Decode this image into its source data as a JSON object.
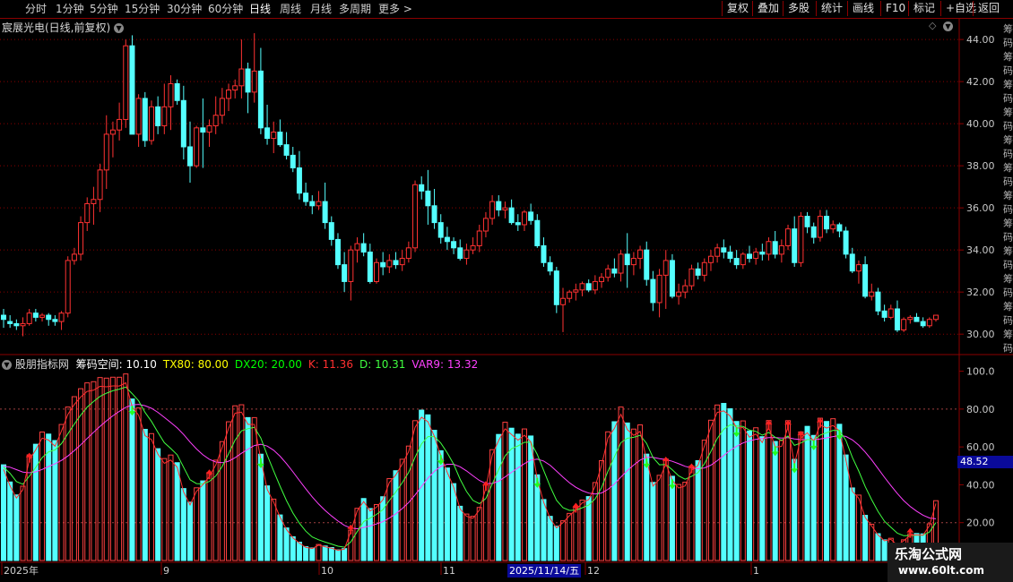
{
  "toolbar": {
    "periods": [
      "分时",
      "1分钟",
      "5分钟",
      "15分钟",
      "30分钟",
      "60分钟",
      "日线",
      "周线",
      "月线",
      "多周期",
      "更多"
    ],
    "active_period": "日线",
    "buttons": [
      "复权",
      "叠加",
      "多股",
      "统计",
      "画线",
      "F10",
      "标记",
      "+自选",
      "返回"
    ]
  },
  "main_panel": {
    "title": "宸展光电(日线,前复权)",
    "y_ticks": [
      "44.00",
      "42.00",
      "40.00",
      "38.00",
      "36.00",
      "34.00",
      "32.00",
      "30.00"
    ],
    "price_range": [
      29.2,
      44.6
    ]
  },
  "indicator_panel": {
    "title": "股朋指标网",
    "values": [
      {
        "label": "筹码空间:",
        "value": "10.10",
        "color": "#ffffff"
      },
      {
        "label": "TX80:",
        "value": "80.00",
        "color": "#ffff00"
      },
      {
        "label": "DX20:",
        "value": "20.00",
        "color": "#00ff00"
      },
      {
        "label": "K:",
        "value": "11.36",
        "color": "#ff3030"
      },
      {
        "label": "D:",
        "value": "10.31",
        "color": "#40ff40"
      },
      {
        "label": "VAR9:",
        "value": "13.32",
        "color": "#ff40ff"
      }
    ],
    "y_ticks": [
      "100.0",
      "80.00",
      "60.00",
      "40.00",
      "20.00"
    ],
    "current_value": "48.52",
    "range": [
      0,
      105
    ]
  },
  "x_axis": {
    "labels": [
      "2025年",
      "9",
      "10",
      "11",
      "2025/11/14/五",
      "12",
      "1"
    ],
    "highlight": "2025/11/14/五"
  },
  "right_strip_chars": [
    "筹",
    "码",
    "筹",
    "码",
    "筹",
    "码",
    "筹",
    "码",
    "筹",
    "码",
    "筹",
    "码",
    "筹",
    "码",
    "筹",
    "码",
    "筹",
    "码",
    "筹",
    "码",
    "筹",
    "码",
    "筹",
    "码"
  ],
  "watermark": {
    "line1": "乐淘公式网",
    "line2": "www.60lt.com"
  },
  "colors": {
    "up": "#ff3232",
    "down": "#54ffff",
    "grid": "#8b0000",
    "axis_text": "#c8c8c8"
  },
  "chart_data": {
    "type": "candlestick",
    "candles": [
      [
        30.9,
        31.2,
        30.3,
        30.7
      ],
      [
        30.6,
        30.9,
        30.3,
        30.5
      ],
      [
        30.5,
        30.7,
        30.2,
        30.4
      ],
      [
        30.4,
        30.8,
        29.9,
        30.5
      ],
      [
        30.5,
        31.2,
        30.4,
        31.0
      ],
      [
        31.0,
        31.2,
        30.6,
        30.8
      ],
      [
        30.8,
        31.0,
        30.6,
        30.9
      ],
      [
        30.9,
        31.0,
        30.4,
        30.7
      ],
      [
        30.7,
        30.9,
        30.4,
        30.6
      ],
      [
        30.6,
        31.1,
        30.2,
        31.0
      ],
      [
        31.0,
        33.7,
        30.8,
        33.5
      ],
      [
        33.5,
        34.1,
        33.3,
        33.8
      ],
      [
        33.8,
        35.6,
        33.5,
        35.3
      ],
      [
        35.3,
        36.5,
        34.9,
        36.2
      ],
      [
        36.2,
        37.0,
        35.2,
        36.4
      ],
      [
        36.4,
        38.1,
        35.8,
        37.8
      ],
      [
        37.8,
        40.4,
        36.9,
        39.5
      ],
      [
        39.5,
        40.1,
        38.4,
        39.7
      ],
      [
        39.7,
        41.0,
        39.2,
        40.2
      ],
      [
        40.2,
        44.0,
        39.8,
        43.7
      ],
      [
        43.7,
        44.2,
        40.0,
        39.5
      ],
      [
        39.5,
        41.4,
        38.9,
        41.2
      ],
      [
        41.2,
        41.5,
        38.9,
        39.2
      ],
      [
        39.2,
        41.1,
        39.0,
        40.8
      ],
      [
        40.8,
        41.3,
        39.5,
        39.9
      ],
      [
        39.9,
        41.9,
        39.5,
        40.8
      ],
      [
        40.8,
        42.3,
        39.7,
        41.9
      ],
      [
        41.9,
        42.1,
        40.9,
        41.1
      ],
      [
        41.1,
        41.8,
        38.3,
        38.9
      ],
      [
        38.9,
        40.1,
        37.2,
        38.0
      ],
      [
        38.0,
        39.9,
        37.9,
        39.8
      ],
      [
        39.8,
        41.2,
        37.9,
        39.6
      ],
      [
        39.6,
        40.2,
        38.9,
        39.9
      ],
      [
        39.9,
        41.3,
        39.5,
        40.4
      ],
      [
        40.4,
        41.7,
        40.0,
        41.2
      ],
      [
        41.2,
        41.9,
        40.6,
        41.6
      ],
      [
        41.6,
        42.1,
        41.2,
        41.8
      ],
      [
        41.8,
        44.0,
        41.2,
        42.6
      ],
      [
        42.6,
        42.9,
        40.5,
        41.5
      ],
      [
        41.5,
        44.3,
        41.0,
        42.5
      ],
      [
        42.5,
        43.6,
        39.5,
        39.8
      ],
      [
        39.8,
        40.9,
        39.0,
        39.3
      ],
      [
        39.3,
        40.1,
        38.6,
        39.6
      ],
      [
        39.6,
        40.2,
        38.9,
        39.0
      ],
      [
        39.0,
        39.6,
        38.3,
        38.5
      ],
      [
        38.5,
        38.9,
        37.7,
        37.9
      ],
      [
        37.9,
        38.7,
        36.4,
        36.7
      ],
      [
        36.7,
        37.2,
        36.1,
        36.3
      ],
      [
        36.3,
        36.6,
        35.7,
        36.1
      ],
      [
        36.1,
        36.8,
        35.9,
        36.3
      ],
      [
        36.3,
        37.2,
        35.0,
        35.3
      ],
      [
        35.3,
        35.6,
        34.2,
        34.5
      ],
      [
        34.5,
        34.8,
        33.1,
        33.3
      ],
      [
        33.3,
        33.9,
        32.0,
        32.5
      ],
      [
        32.5,
        34.2,
        31.6,
        34.0
      ],
      [
        34.0,
        34.6,
        33.4,
        34.3
      ],
      [
        34.3,
        34.8,
        33.7,
        33.9
      ],
      [
        33.9,
        34.3,
        32.4,
        32.5
      ],
      [
        32.5,
        33.6,
        32.4,
        33.4
      ],
      [
        33.4,
        33.9,
        32.8,
        33.2
      ],
      [
        33.2,
        33.8,
        32.9,
        33.5
      ],
      [
        33.5,
        33.9,
        33.1,
        33.3
      ],
      [
        33.3,
        34.0,
        33.0,
        33.6
      ],
      [
        33.6,
        34.4,
        33.4,
        34.1
      ],
      [
        34.1,
        37.3,
        33.9,
        37.1
      ],
      [
        37.1,
        37.5,
        36.4,
        36.8
      ],
      [
        36.8,
        37.8,
        35.2,
        36.1
      ],
      [
        36.1,
        36.9,
        35.0,
        35.3
      ],
      [
        35.3,
        35.7,
        34.3,
        34.6
      ],
      [
        34.6,
        35.1,
        34.0,
        34.4
      ],
      [
        34.4,
        34.6,
        33.8,
        34.1
      ],
      [
        34.1,
        34.5,
        33.5,
        33.6
      ],
      [
        33.6,
        34.3,
        33.3,
        34.0
      ],
      [
        34.0,
        34.6,
        33.8,
        34.2
      ],
      [
        34.2,
        35.2,
        33.9,
        34.9
      ],
      [
        34.9,
        35.8,
        34.6,
        35.5
      ],
      [
        35.5,
        36.6,
        35.2,
        36.3
      ],
      [
        36.3,
        36.6,
        35.6,
        35.9
      ],
      [
        35.9,
        36.3,
        35.5,
        36.0
      ],
      [
        36.0,
        36.4,
        35.2,
        35.3
      ],
      [
        35.3,
        35.7,
        34.9,
        35.2
      ],
      [
        35.2,
        35.9,
        34.9,
        35.8
      ],
      [
        35.8,
        36.2,
        35.2,
        35.4
      ],
      [
        35.4,
        35.7,
        34.1,
        34.2
      ],
      [
        34.2,
        34.6,
        33.2,
        33.4
      ],
      [
        33.4,
        33.7,
        32.8,
        33.0
      ],
      [
        33.0,
        33.2,
        31.0,
        31.4
      ],
      [
        31.4,
        32.2,
        30.1,
        31.7
      ],
      [
        31.7,
        32.1,
        31.5,
        32.0
      ],
      [
        32.0,
        32.4,
        31.6,
        32.1
      ],
      [
        32.1,
        32.5,
        31.8,
        32.4
      ],
      [
        32.4,
        32.6,
        32.0,
        32.1
      ],
      [
        32.1,
        32.8,
        31.9,
        32.5
      ],
      [
        32.5,
        32.9,
        32.2,
        32.7
      ],
      [
        32.7,
        33.3,
        32.5,
        33.1
      ],
      [
        33.1,
        33.6,
        32.7,
        32.9
      ],
      [
        32.9,
        34.0,
        32.5,
        33.8
      ],
      [
        33.8,
        34.8,
        32.2,
        33.3
      ],
      [
        33.3,
        33.9,
        32.8,
        33.6
      ],
      [
        33.6,
        34.2,
        33.1,
        34.0
      ],
      [
        34.0,
        34.4,
        32.3,
        32.6
      ],
      [
        32.6,
        33.0,
        31.1,
        31.5
      ],
      [
        31.5,
        33.1,
        30.8,
        32.8
      ],
      [
        32.8,
        34.0,
        31.2,
        33.5
      ],
      [
        33.5,
        33.8,
        31.7,
        31.8
      ],
      [
        31.8,
        32.4,
        31.4,
        32.0
      ],
      [
        32.0,
        32.6,
        31.7,
        32.3
      ],
      [
        32.3,
        33.3,
        32.1,
        33.1
      ],
      [
        33.1,
        33.4,
        32.6,
        32.8
      ],
      [
        32.8,
        33.6,
        32.5,
        33.4
      ],
      [
        33.4,
        34.0,
        33.0,
        33.7
      ],
      [
        33.7,
        34.3,
        33.4,
        34.1
      ],
      [
        34.1,
        34.5,
        33.6,
        33.9
      ],
      [
        33.9,
        34.2,
        33.4,
        33.6
      ],
      [
        33.6,
        34.0,
        33.1,
        33.3
      ],
      [
        33.3,
        33.9,
        33.1,
        33.8
      ],
      [
        33.8,
        34.2,
        33.4,
        33.6
      ],
      [
        33.6,
        34.1,
        33.3,
        33.9
      ],
      [
        33.9,
        34.3,
        33.5,
        33.8
      ],
      [
        33.8,
        34.6,
        33.5,
        34.4
      ],
      [
        34.4,
        34.9,
        33.6,
        33.8
      ],
      [
        33.8,
        34.5,
        33.4,
        34.2
      ],
      [
        34.2,
        35.2,
        34.0,
        35.0
      ],
      [
        35.0,
        35.6,
        33.2,
        33.4
      ],
      [
        33.4,
        35.8,
        33.2,
        35.6
      ],
      [
        35.6,
        35.8,
        34.8,
        35.1
      ],
      [
        35.1,
        35.3,
        34.3,
        34.6
      ],
      [
        34.6,
        35.9,
        34.4,
        35.6
      ],
      [
        35.6,
        35.9,
        34.8,
        35.0
      ],
      [
        35.0,
        35.4,
        34.8,
        35.2
      ],
      [
        35.2,
        35.3,
        34.6,
        34.9
      ],
      [
        34.9,
        35.1,
        33.6,
        33.8
      ],
      [
        33.8,
        34.1,
        32.9,
        33.0
      ],
      [
        33.0,
        33.5,
        32.4,
        33.3
      ],
      [
        33.3,
        33.7,
        31.7,
        31.8
      ],
      [
        31.8,
        32.4,
        31.6,
        32.0
      ],
      [
        32.0,
        32.2,
        30.9,
        31.1
      ],
      [
        31.1,
        31.4,
        30.6,
        30.8
      ],
      [
        30.8,
        31.4,
        30.7,
        31.2
      ],
      [
        31.2,
        31.6,
        30.1,
        30.2
      ],
      [
        30.2,
        30.8,
        30.1,
        30.7
      ],
      [
        30.7,
        30.9,
        30.5,
        30.8
      ],
      [
        30.8,
        31.0,
        30.6,
        30.6
      ],
      [
        30.6,
        30.8,
        30.3,
        30.4
      ],
      [
        30.4,
        30.8,
        30.3,
        30.7
      ],
      [
        30.7,
        30.9,
        30.6,
        30.9
      ]
    ]
  }
}
